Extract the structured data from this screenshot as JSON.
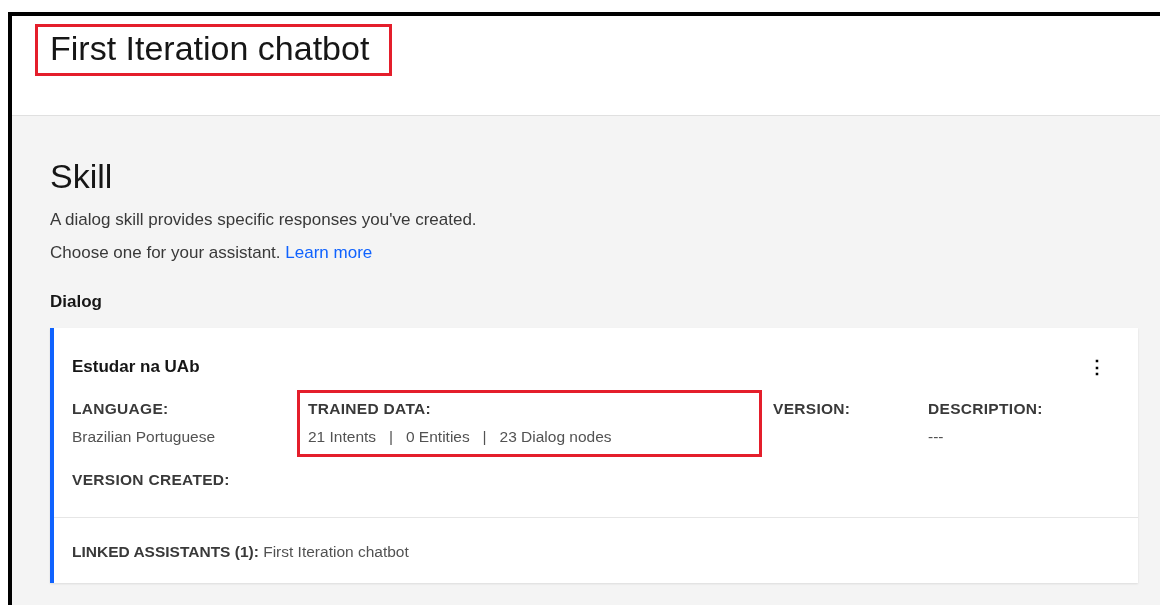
{
  "header": {
    "title": "First Iteration chatbot",
    "highlighted": true
  },
  "section": {
    "title": "Skill",
    "description": "A dialog skill provides specific responses you've created.",
    "prompt": "Choose one for your assistant.",
    "link": "Learn more"
  },
  "group_title": "Dialog",
  "skill_card": {
    "name": "Estudar na UAb",
    "menu": "⋮",
    "fields": [
      {
        "label": "LANGUAGE:",
        "value": "Brazilian Portuguese",
        "highlighted": false
      },
      {
        "label": "TRAINED DATA:",
        "value": "21 Intents   |   0 Entities   |   23 Dialog nodes",
        "highlighted": true
      },
      {
        "label": "VERSION:",
        "highlighted": false
      },
      {
        "label": "DESCRIPTION:",
        "value": "---",
        "highlighted": false
      },
      {
        "label": "VERSION CREATED:",
        "highlighted": false
      }
    ],
    "linked": "**LINKED ASSISTANTS (1):** First Iteration chatbot"
  }
}
